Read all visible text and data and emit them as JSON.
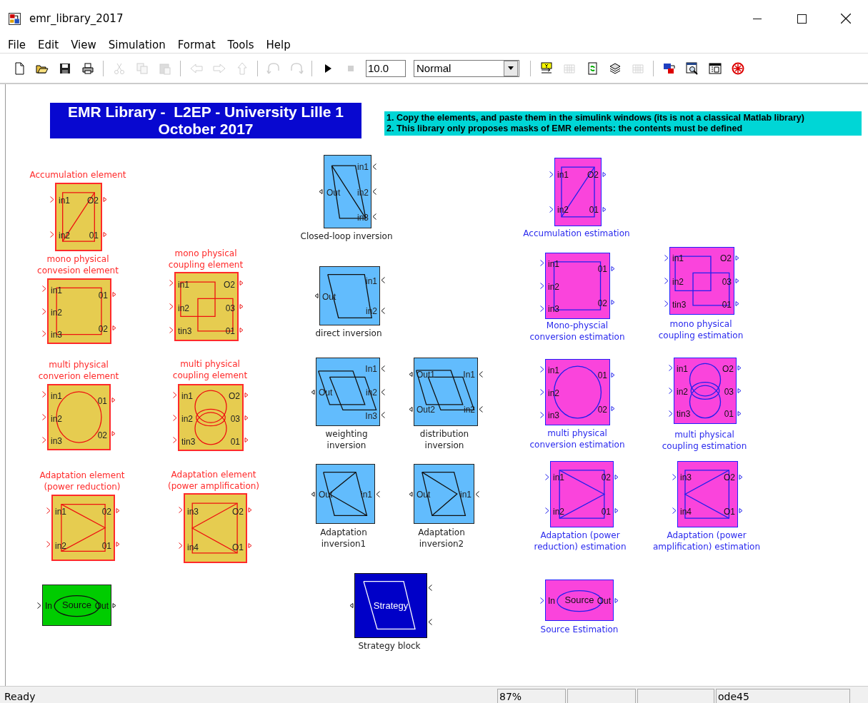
{
  "window": {
    "title": "emr_library_2017"
  },
  "menu": [
    "File",
    "Edit",
    "View",
    "Simulation",
    "Format",
    "Tools",
    "Help"
  ],
  "toolbar": [
    {
      "kind": "new",
      "disabled": false
    },
    {
      "kind": "open",
      "disabled": false
    },
    {
      "kind": "save",
      "disabled": false
    },
    {
      "kind": "print",
      "disabled": false
    },
    {
      "kind": "separator"
    },
    {
      "kind": "cut",
      "disabled": true
    },
    {
      "kind": "copy",
      "disabled": true
    },
    {
      "kind": "paste",
      "disabled": true
    },
    {
      "kind": "separator"
    },
    {
      "kind": "back",
      "disabled": true
    },
    {
      "kind": "forward",
      "disabled": true
    },
    {
      "kind": "up",
      "disabled": true
    },
    {
      "kind": "separator"
    },
    {
      "kind": "undo",
      "disabled": true
    },
    {
      "kind": "redo",
      "disabled": true
    },
    {
      "kind": "separator"
    },
    {
      "kind": "play",
      "disabled": false
    },
    {
      "kind": "stop",
      "disabled": true
    }
  ],
  "stop_time": "10.0",
  "mode": "Normal",
  "toolbar2": [
    {
      "kind": "separator"
    },
    {
      "kind": "build",
      "disabled": false
    },
    {
      "kind": "grid",
      "disabled": true
    },
    {
      "kind": "refresh",
      "disabled": false
    },
    {
      "kind": "layers",
      "disabled": false
    },
    {
      "kind": "grid",
      "disabled": true
    },
    {
      "kind": "separator"
    },
    {
      "kind": "library",
      "disabled": false
    },
    {
      "kind": "explorer",
      "disabled": false
    },
    {
      "kind": "window",
      "disabled": false
    },
    {
      "kind": "target",
      "disabled": false
    }
  ],
  "title_box": "EMR Library -  L2EP - University Lille 1\nOctober 2017",
  "note": [
    "1. Copy the elements, and paste them in the simulink windows (its is not a classical Matlab library)",
    "2. This library only proposes masks of EMR elements: the contents must be defined"
  ],
  "blocks": [
    {
      "kind": "element",
      "symbol": {
        "kind": "accumulation"
      },
      "caption": "Accumulation element",
      "inputs": [
        "in1",
        "in2"
      ],
      "outputs": [
        "O2",
        "01"
      ]
    },
    {
      "kind": "element",
      "symbol": {
        "kind": "conversion"
      },
      "caption": "mono physical\nconvesion element",
      "inputs": [
        "in1",
        "in2",
        "in3"
      ],
      "outputs": [
        "01",
        "02"
      ]
    },
    {
      "kind": "element",
      "symbol": {
        "kind": "coupling"
      },
      "caption": "mono physical\ncoupling element",
      "inputs": [
        "in1",
        "in2",
        "tin3"
      ],
      "outputs": [
        "O2",
        "03",
        "01"
      ]
    },
    {
      "kind": "element",
      "symbol": {
        "kind": "multi-conversion"
      },
      "caption": "multi physical\nconverion element",
      "inputs": [
        "in1",
        "in2",
        "in3"
      ],
      "outputs": [
        "01",
        "02"
      ]
    },
    {
      "kind": "element",
      "symbol": {
        "kind": "multi-coupling"
      },
      "caption": "multi physical\ncoupling element",
      "inputs": [
        "in1",
        "in2",
        "tin3"
      ],
      "outputs": [
        "O2",
        "03",
        "01"
      ]
    },
    {
      "kind": "element",
      "symbol": {
        "kind": "reduction"
      },
      "caption": "Adaptation element\n(power reduction)",
      "inputs": [
        "in1",
        "in2"
      ],
      "outputs": [
        "02",
        "01"
      ]
    },
    {
      "kind": "element",
      "symbol": {
        "kind": "amplification"
      },
      "caption": "Adaptation element\n(power amplification)",
      "inputs": [
        "in3",
        "in4"
      ],
      "outputs": [
        "O2",
        "O1"
      ]
    },
    {
      "kind": "source",
      "symbol": {
        "kind": "oval"
      },
      "center_label": "Source",
      "inputs": [
        "In"
      ],
      "outputs": [
        "Out"
      ]
    },
    {
      "kind": "inversion",
      "symbol": {
        "kind": "closed-loop"
      },
      "caption": "Closed-loop inversion",
      "inputs": [
        "in1",
        "in2",
        "in3"
      ],
      "outputs": [
        "Out"
      ]
    },
    {
      "kind": "inversion",
      "symbol": {
        "kind": "direct"
      },
      "caption": "direct inversion",
      "inputs": [
        "in1",
        "in2"
      ],
      "outputs": [
        "Out"
      ]
    },
    {
      "kind": "inversion",
      "symbol": {
        "kind": "weighting"
      },
      "caption": "weighting\ninversion",
      "inputs": [
        "In1",
        "in2",
        "In3"
      ],
      "outputs": [
        "Out"
      ]
    },
    {
      "kind": "inversion",
      "symbol": {
        "kind": "distribution"
      },
      "caption": "distribution\ninversion",
      "inputs": [
        "In1",
        "in2"
      ],
      "outputs": [
        "Out1",
        "Out2"
      ]
    },
    {
      "kind": "inversion",
      "symbol": {
        "kind": "adapt-inv1"
      },
      "caption": "Adaptation\ninversion1",
      "inputs": [
        "in1"
      ],
      "outputs": [
        "Out"
      ]
    },
    {
      "kind": "inversion",
      "symbol": {
        "kind": "adapt-inv2"
      },
      "caption": "Adaptation\ninversion2",
      "inputs": [
        "in1"
      ],
      "outputs": [
        "Out"
      ]
    },
    {
      "kind": "strategy",
      "symbol": {
        "kind": "strategy"
      },
      "center_label": "Strategy",
      "caption": "Strategy block"
    },
    {
      "kind": "estimation",
      "symbol": {
        "kind": "accumulation"
      },
      "caption": "Accumulation estimation",
      "inputs": [
        "in1",
        "in2"
      ],
      "outputs": [
        "O2",
        "01"
      ]
    },
    {
      "kind": "estimation",
      "symbol": {
        "kind": "conversion"
      },
      "caption": "Mono-physcial\nconversion estimation",
      "inputs": [
        "in1",
        "in2",
        "in3"
      ],
      "outputs": [
        "01",
        "02"
      ]
    },
    {
      "kind": "estimation",
      "symbol": {
        "kind": "coupling"
      },
      "caption": "mono physical\ncoupling estimation",
      "inputs": [
        "in1",
        "in2",
        "tin3"
      ],
      "outputs": [
        "O2",
        "03",
        "01"
      ]
    },
    {
      "kind": "estimation",
      "symbol": {
        "kind": "multi-conversion"
      },
      "caption": "multi physical\nconversion estimation",
      "inputs": [
        "in1",
        "in2",
        "in3"
      ],
      "outputs": [
        "01",
        "02"
      ]
    },
    {
      "kind": "estimation",
      "symbol": {
        "kind": "multi-coupling"
      },
      "caption": "multi physical\ncoupling estimation",
      "inputs": [
        "in1",
        "in2",
        "tin3"
      ],
      "outputs": [
        "O2",
        "03",
        "01"
      ]
    },
    {
      "kind": "estimation",
      "symbol": {
        "kind": "reduction"
      },
      "caption": "Adaptation (power\nreduction) estimation",
      "inputs": [
        "in1",
        "in2"
      ],
      "outputs": [
        "02",
        "01"
      ]
    },
    {
      "kind": "estimation",
      "symbol": {
        "kind": "amplification"
      },
      "caption": "Adaptation (power\namplification) estimation",
      "inputs": [
        "in3",
        "in4"
      ],
      "outputs": [
        "O2",
        "O1"
      ]
    },
    {
      "kind": "estimation",
      "symbol": {
        "kind": "oval"
      },
      "center_label": "Source",
      "caption": "Source Estimation",
      "inputs": [
        "In"
      ],
      "outputs": [
        "Out"
      ]
    }
  ],
  "status_bar": {
    "message": "Ready",
    "zoom": "87%",
    "solver": "ode45"
  }
}
